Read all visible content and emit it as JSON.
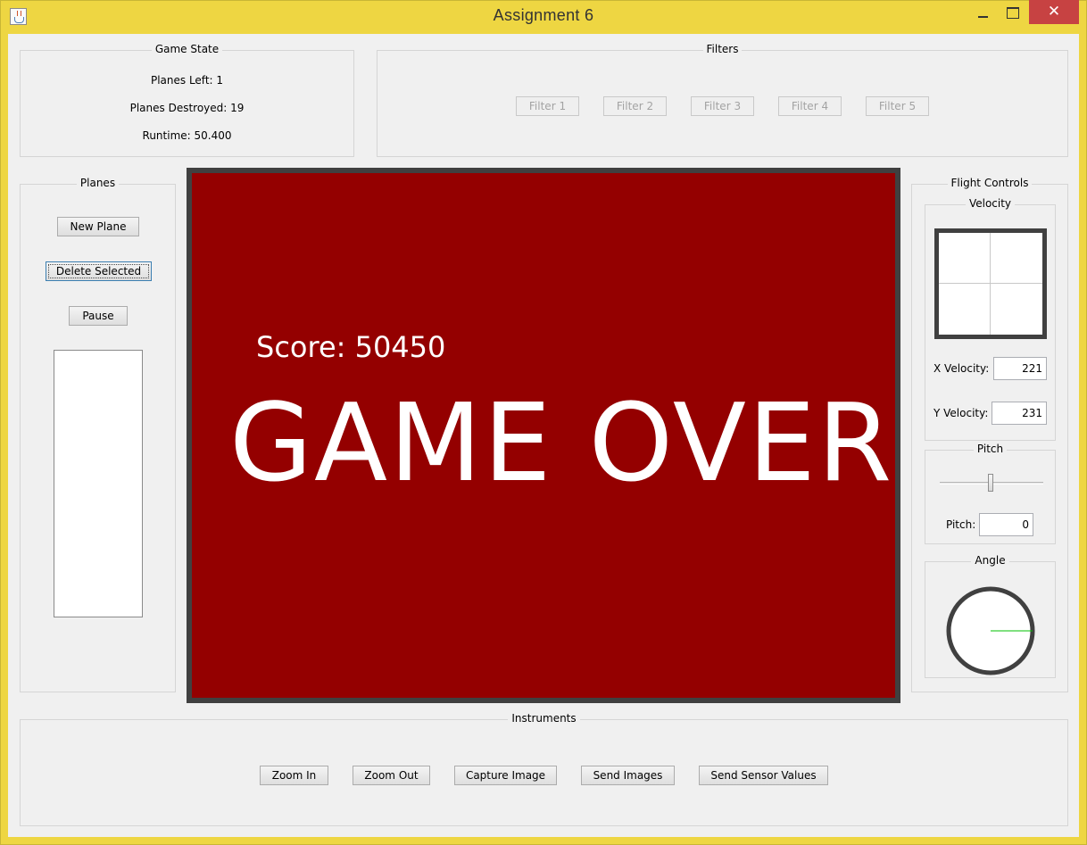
{
  "window": {
    "title": "Assignment 6",
    "close_glyph": "✕"
  },
  "game_state": {
    "title": "Game State",
    "planes_left": "Planes Left: 1",
    "planes_destroyed": "Planes Destroyed: 19",
    "runtime": "Runtime: 50.400"
  },
  "filters": {
    "title": "Filters",
    "buttons": [
      "Filter 1",
      "Filter 2",
      "Filter 3",
      "Filter 4",
      "Filter 5"
    ]
  },
  "planes": {
    "title": "Planes",
    "new_plane": "New Plane",
    "delete_selected": "Delete Selected",
    "pause": "Pause",
    "list_items": []
  },
  "game": {
    "score": "Score: 50450",
    "message": "GAME OVER",
    "background_color": "#940000"
  },
  "flight_controls": {
    "title": "Flight Controls",
    "velocity": {
      "title": "Velocity",
      "x_label": "X Velocity:",
      "x_value": "221",
      "y_label": "Y Velocity:",
      "y_value": "231"
    },
    "pitch": {
      "title": "Pitch",
      "label": "Pitch:",
      "value": "0",
      "slider_fraction": 0.5
    },
    "angle": {
      "title": "Angle",
      "indicator_degrees": 0,
      "indicator_color": "#00c000"
    }
  },
  "instruments": {
    "title": "Instruments",
    "buttons": [
      "Zoom In",
      "Zoom Out",
      "Capture Image",
      "Send Images",
      "Send Sensor Values"
    ]
  },
  "icons": {
    "app": "java-cup-icon",
    "minimize": "minimize-icon",
    "maximize": "maximize-icon",
    "close": "close-icon"
  }
}
